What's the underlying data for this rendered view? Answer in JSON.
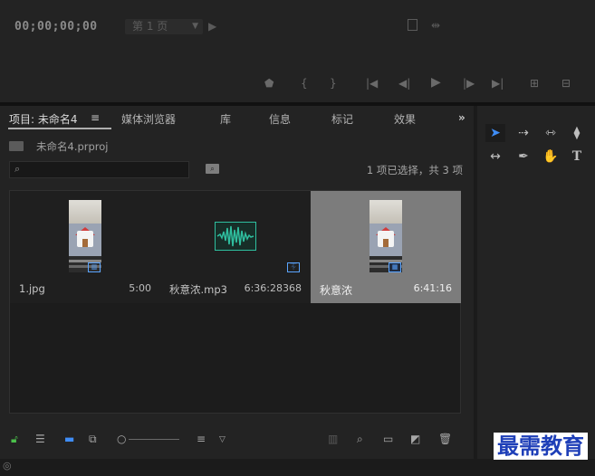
{
  "monitor": {
    "timecode": "00;00;00;00",
    "page_select": "第 1 页"
  },
  "tabs": [
    {
      "label": "项目: 未命名4",
      "active": true
    },
    {
      "label": "媒体浏览器"
    },
    {
      "label": "库"
    },
    {
      "label": "信息"
    },
    {
      "label": "标记"
    },
    {
      "label": "效果"
    }
  ],
  "project": {
    "path": "未命名4.prproj",
    "selection_status": "1 项已选择，共 3 项",
    "search_placeholder": ""
  },
  "clips": [
    {
      "name": "1.jpg",
      "duration": "5:00",
      "selected": false
    },
    {
      "name": "秋意浓.mp3",
      "duration": "6:36:28368",
      "selected": false
    },
    {
      "name": "秋意浓",
      "duration": "6:41:16",
      "selected": true
    }
  ],
  "colors": {
    "accent": "#3f8df6",
    "audio_wave": "#2fbf9f",
    "panel_bg": "#232323",
    "selected_clip_bg": "#7c7c7c"
  },
  "watermark": "最需教育"
}
